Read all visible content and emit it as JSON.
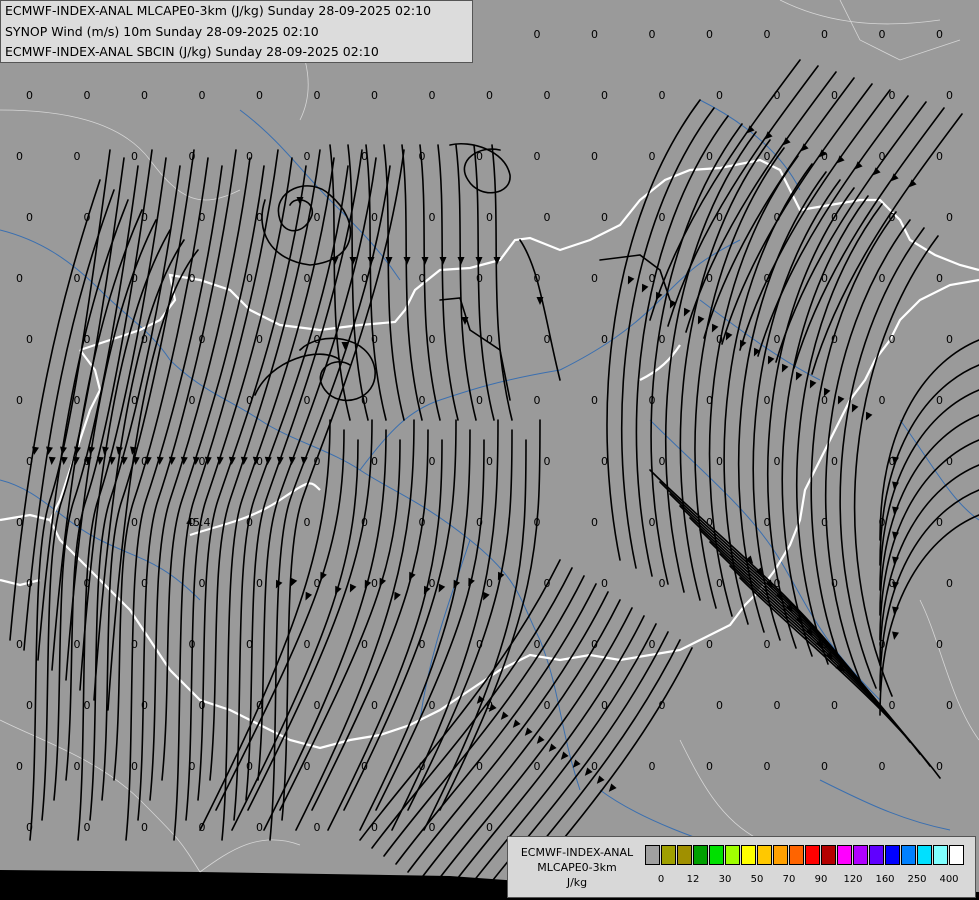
{
  "header_lines": [
    "ECMWF-INDEX-ANAL MLCAPE0-3km (J/kg) Sunday 28-09-2025 02:10",
    "SYNOP Wind (m/s) 10m Sunday 28-09-2025 02:10",
    "ECMWF-INDEX-ANAL SBCIN (J/kg) Sunday 28-09-2025 02:10"
  ],
  "colorbar": {
    "title_line1": "ECMWF-INDEX-ANAL",
    "title_line2": "MLCAPE0-3km",
    "units": "J/kg",
    "colors": [
      "#a0a0a0",
      "#a0a000",
      "#a09000",
      "#00a000",
      "#00e000",
      "#a0ff00",
      "#ffff00",
      "#ffc800",
      "#ffa000",
      "#ff6400",
      "#ff0000",
      "#b40000",
      "#ff00ff",
      "#b000ff",
      "#6000ff",
      "#0000ff",
      "#0080ff",
      "#00e0ff",
      "#80ffff",
      "#ffffff"
    ],
    "tick_labels": [
      "0",
      "12",
      "30",
      "50",
      "70",
      "90",
      "120",
      "160",
      "250",
      "400"
    ]
  },
  "cape_labels": [
    "45.4"
  ],
  "cin_value": "0",
  "colors": {
    "background": "#9a9a9a",
    "border": "#ffffff",
    "river": "#3a6fb0",
    "streamline": "#000000"
  }
}
